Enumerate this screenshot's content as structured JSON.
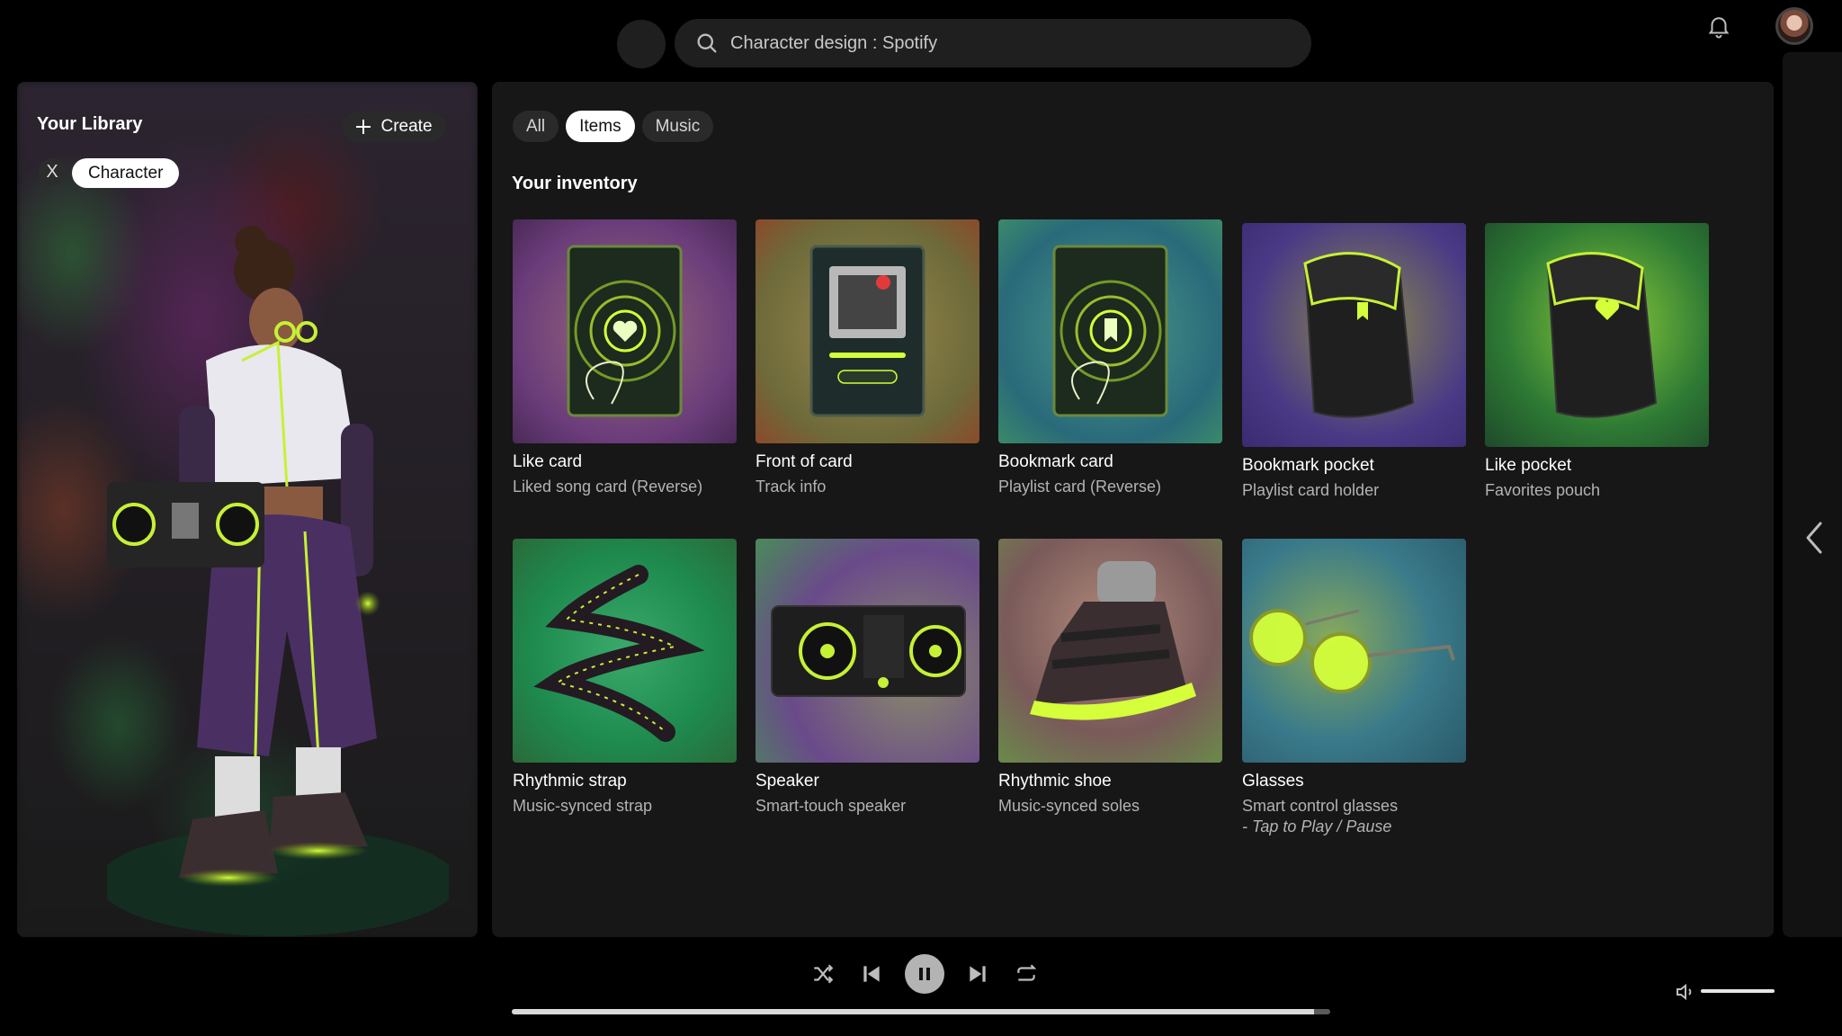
{
  "search": {
    "value": "Character design : Spotify"
  },
  "library": {
    "title": "Your Library",
    "create_label": "Create",
    "filter_close": "X",
    "filter_chip": "Character"
  },
  "tabs": [
    {
      "label": "All",
      "active": false
    },
    {
      "label": "Items",
      "active": true
    },
    {
      "label": "Music",
      "active": false
    }
  ],
  "inventory": {
    "title": "Your inventory",
    "items": [
      {
        "name": "Like card",
        "subtitle": "Liked song card (Reverse)",
        "bg": "#7a4c7e"
      },
      {
        "name": "Front of card",
        "subtitle": "Track info",
        "bg": "#8a7a3e"
      },
      {
        "name": "Bookmark card",
        "subtitle": "Playlist card (Reverse)",
        "bg": "#2f7a7a"
      },
      {
        "name": "Bookmark pocket",
        "subtitle": "Playlist card holder",
        "bg": "#4f3f86"
      },
      {
        "name": "Like pocket",
        "subtitle": "Favorites pouch",
        "bg": "#2f7a34"
      },
      {
        "name": "Rhythmic strap",
        "subtitle": "Music-synced strap",
        "bg": "#2a8a5a"
      },
      {
        "name": "Speaker",
        "subtitle": "Smart-touch speaker",
        "bg": "#6a4a8a"
      },
      {
        "name": "Rhythmic shoe",
        "subtitle": "Music-synced soles",
        "bg": "#8a6a5a"
      },
      {
        "name": "Glasses",
        "subtitle": "Smart control glasses",
        "subtitle2": "- Tap to Play / Pause",
        "bg": "#3a7a7a"
      }
    ]
  },
  "player": {
    "progress": 0.98,
    "volume": 1.0,
    "state": "playing"
  },
  "colors": {
    "accent": "#c6f135",
    "background": "#000000",
    "panel": "#171717"
  }
}
